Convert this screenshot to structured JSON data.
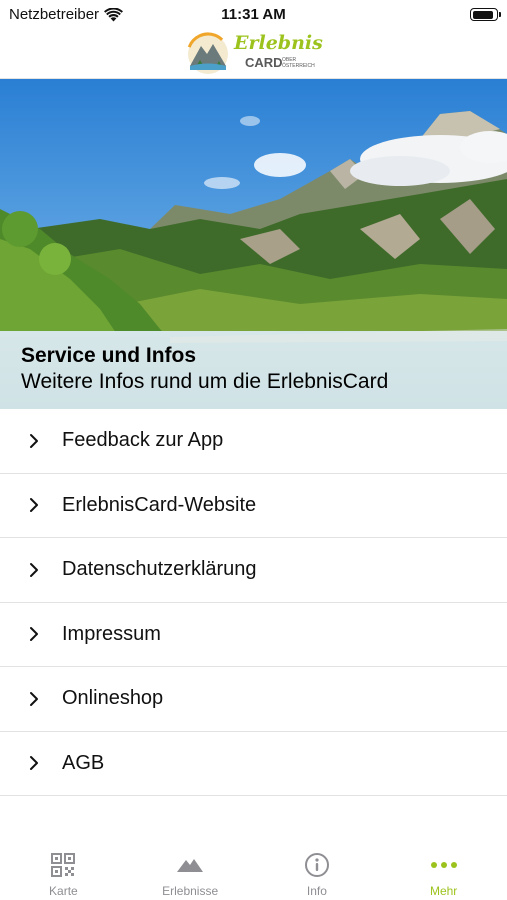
{
  "status_bar": {
    "carrier": "Netzbetreiber",
    "time": "11:31 AM",
    "battery_level": 0.9
  },
  "header": {
    "logo_text_main": "Erlebnis",
    "logo_text_card": "CARD",
    "logo_text_region_1": "OBER",
    "logo_text_region_2": "ÖSTERREICH",
    "logo_icon": "mountain-sun-logo-icon"
  },
  "hero": {
    "title": "Service und Infos",
    "subtitle": "Weitere Infos rund um die ErlebnisCard"
  },
  "menu": {
    "items": [
      {
        "label": "Feedback zur App",
        "icon": "chevron-right-icon"
      },
      {
        "label": "ErlebnisCard-Website",
        "icon": "chevron-right-icon"
      },
      {
        "label": "Datenschutzerklärung",
        "icon": "chevron-right-icon"
      },
      {
        "label": "Impressum",
        "icon": "chevron-right-icon"
      },
      {
        "label": "Onlineshop",
        "icon": "chevron-right-icon"
      },
      {
        "label": "AGB",
        "icon": "chevron-right-icon"
      }
    ]
  },
  "tabbar": {
    "tabs": [
      {
        "label": "Karte",
        "icon": "qr-code-icon",
        "active": false
      },
      {
        "label": "Erlebnisse",
        "icon": "mountain-icon",
        "active": false
      },
      {
        "label": "Info",
        "icon": "info-circle-icon",
        "active": false
      },
      {
        "label": "Mehr",
        "icon": "more-dots-icon",
        "active": true
      }
    ]
  },
  "colors": {
    "accent": "#9cc31d",
    "tab_inactive": "#8e8e93",
    "divider": "#e2e2e2"
  }
}
